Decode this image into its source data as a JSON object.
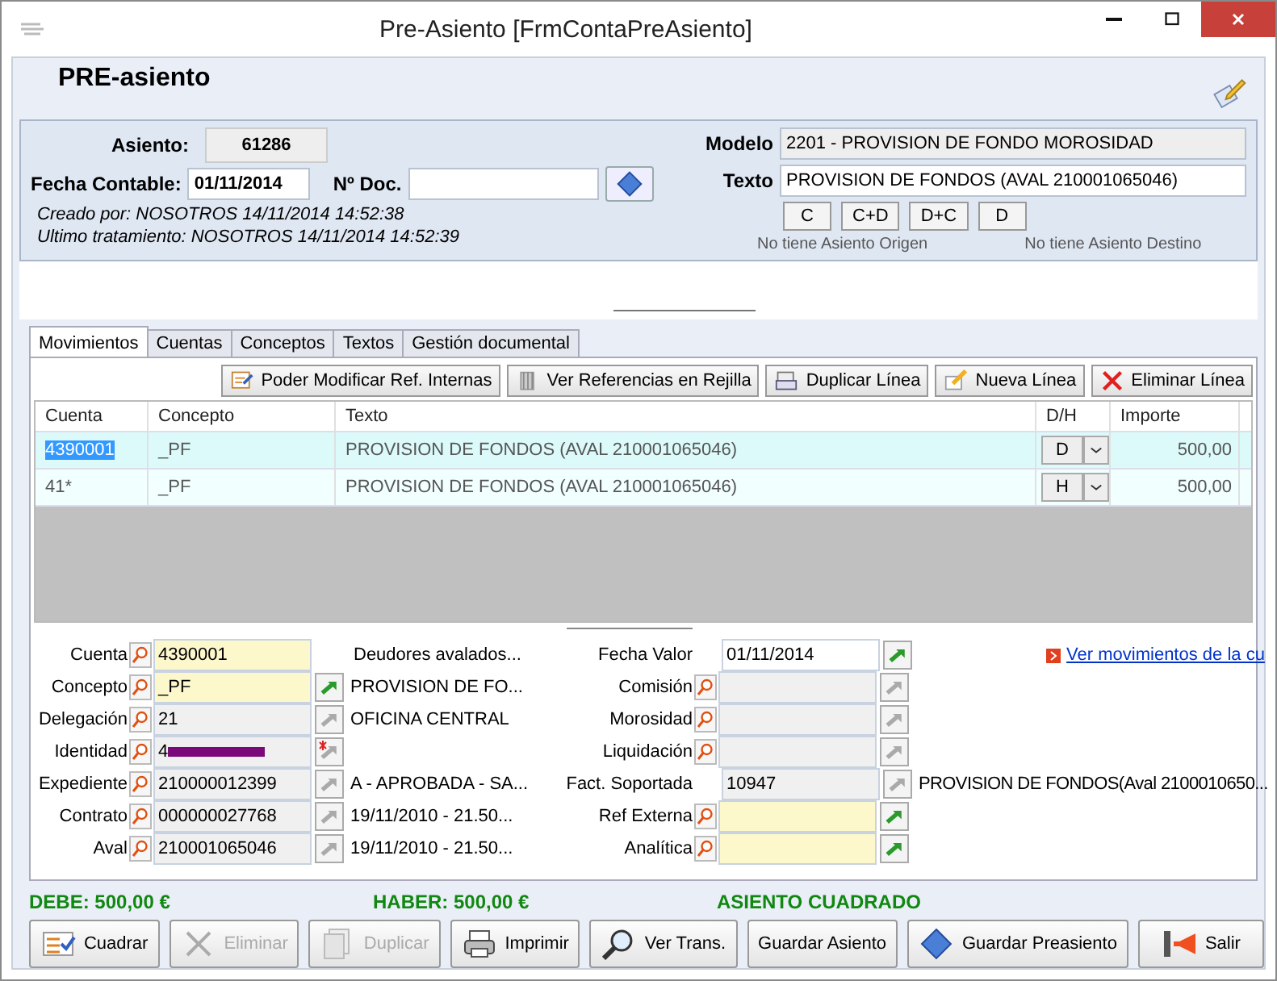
{
  "window": {
    "title": "Pre-Asiento [FrmContaPreAsiento]"
  },
  "header": {
    "title": "PRE-asiento"
  },
  "info": {
    "asiento_label": "Asiento:",
    "asiento": "61286",
    "fecha_label": "Fecha Contable:",
    "fecha": "01/11/2014",
    "doc_label": "Nº Doc.",
    "created": "Creado por: NOSOTROS 14/11/2014 14:52:38",
    "updated": "Ultimo tratamiento: NOSOTROS 14/11/2014 14:52:39",
    "modelo_label": "Modelo",
    "modelo": "2201 - PROVISION DE FONDO MOROSIDAD",
    "texto_label": "Texto",
    "texto": "PROVISION DE FONDOS (AVAL 210001065046)",
    "mini_buttons": [
      "C",
      "C+D",
      "D+C",
      "D"
    ],
    "origin": "No tiene Asiento Origen",
    "destination": "No tiene Asiento Destino"
  },
  "tabs": [
    {
      "label": "Movimientos",
      "selected": true
    },
    {
      "label": "Cuentas",
      "selected": false
    },
    {
      "label": "Conceptos",
      "selected": false
    },
    {
      "label": "Textos",
      "selected": false
    },
    {
      "label": "Gestión documental",
      "selected": false
    }
  ],
  "toolbar": [
    {
      "label": "Poder Modificar Ref. Internas",
      "kind": "edit"
    },
    {
      "label": "Ver Referencias en Rejilla",
      "kind": "grid"
    },
    {
      "label": "Duplicar Línea",
      "kind": "copy"
    },
    {
      "label": "Nueva Línea",
      "kind": "new"
    },
    {
      "label": "Eliminar Línea",
      "kind": "delete"
    }
  ],
  "table": {
    "columns": [
      "Cuenta",
      "Concepto",
      "Texto",
      "D/H",
      "Importe"
    ],
    "rows": [
      {
        "cuenta": "4390001",
        "concepto": "_PF",
        "texto": "PROVISION DE FONDOS (AVAL 210001065046)",
        "dh": "D",
        "importe": "500,00",
        "selected": true
      },
      {
        "cuenta": "41*",
        "concepto": "_PF",
        "texto": "PROVISION DE FONDOS (AVAL 210001065046)",
        "dh": "H",
        "importe": "500,00",
        "selected": false
      }
    ]
  },
  "detail_left": [
    {
      "label": "Cuenta",
      "value": "4390001",
      "desc": "Deudores avalados...",
      "search": true,
      "highlighted": true,
      "disabled": false,
      "go_button": false,
      "go_enabled": false,
      "required": false,
      "redacted": false
    },
    {
      "label": "Concepto",
      "value": "_PF",
      "desc": "PROVISION DE FO...",
      "search": true,
      "highlighted": true,
      "disabled": false,
      "go_button": true,
      "go_enabled": true,
      "required": false,
      "redacted": false
    },
    {
      "label": "Delegación",
      "value": "21",
      "desc": "OFICINA CENTRAL",
      "search": true,
      "highlighted": false,
      "disabled": true,
      "go_button": true,
      "go_enabled": false,
      "required": false,
      "redacted": false
    },
    {
      "label": "Identidad",
      "value": "4",
      "search": true,
      "highlighted": false,
      "disabled": true,
      "go_button": true,
      "go_enabled": false,
      "required": true,
      "redacted": true
    },
    {
      "label": "Expediente",
      "value": "210000012399",
      "desc": "A - APROBADA - SA...",
      "search": true,
      "highlighted": false,
      "disabled": true,
      "go_button": true,
      "go_enabled": false,
      "required": false,
      "redacted": false
    },
    {
      "label": "Contrato",
      "value": "000000027768",
      "desc": "19/11/2010 - 21.50...",
      "search": true,
      "highlighted": false,
      "disabled": true,
      "go_button": true,
      "go_enabled": false,
      "required": false,
      "redacted": false
    },
    {
      "label": "Aval",
      "value": "210001065046",
      "desc": "19/11/2010 - 21.50...",
      "search": true,
      "highlighted": false,
      "disabled": true,
      "go_button": true,
      "go_enabled": false,
      "required": false,
      "redacted": false
    }
  ],
  "detail_right": [
    {
      "label": "Fecha Valor",
      "value": "01/11/2014",
      "search": false,
      "highlighted": false,
      "disabled": false,
      "go_button": true,
      "go_enabled": true
    },
    {
      "label": "Comisión",
      "search": true,
      "highlighted": false,
      "disabled": true,
      "go_button": true,
      "go_enabled": false
    },
    {
      "label": "Morosidad",
      "search": true,
      "highlighted": false,
      "disabled": true,
      "go_button": true,
      "go_enabled": false
    },
    {
      "label": "Liquidación",
      "search": true,
      "highlighted": false,
      "disabled": true,
      "go_button": true,
      "go_enabled": false
    },
    {
      "label": "Fact. Soportada",
      "value": "10947",
      "desc": "PROVISION DE FONDOS(Aval 2100010650...",
      "search": false,
      "highlighted": false,
      "disabled": true,
      "go_button": true,
      "go_enabled": false
    },
    {
      "label": "Ref Externa",
      "search": true,
      "highlighted": true,
      "disabled": false,
      "go_button": true,
      "go_enabled": true
    },
    {
      "label": "Analítica",
      "search": true,
      "highlighted": true,
      "disabled": false,
      "go_button": true,
      "go_enabled": true
    }
  ],
  "link": "Ver movimientos de la cu",
  "totals": {
    "debe": "DEBE: 500,00 €",
    "haber": "HABER: 500,00 €",
    "status": "ASIENTO CUADRADO"
  },
  "buttons": [
    {
      "label": "Cuadrar",
      "kind": "balance",
      "disabled": false
    },
    {
      "label": "Eliminar",
      "kind": "delete",
      "disabled": true
    },
    {
      "label": "Duplicar",
      "kind": "copy",
      "disabled": true
    },
    {
      "label": "Imprimir",
      "kind": "print",
      "disabled": false
    },
    {
      "label": "Ver Trans.",
      "kind": "search",
      "disabled": false
    },
    {
      "label": "Guardar Asiento",
      "kind": "none",
      "disabled": false
    },
    {
      "label": "Guardar Preasiento",
      "kind": "save",
      "disabled": false
    },
    {
      "label": "Salir",
      "kind": "exit",
      "disabled": false
    }
  ]
}
